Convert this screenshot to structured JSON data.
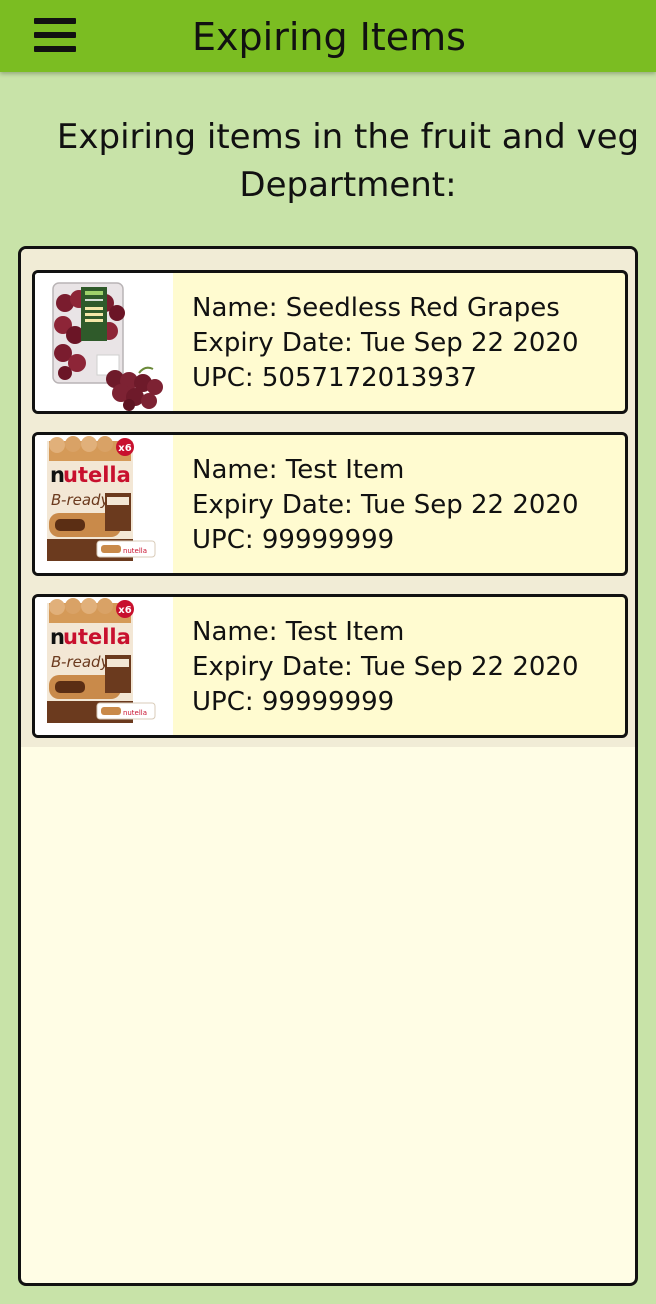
{
  "appbar": {
    "title": "Expiring Items",
    "menu_icon": "hamburger-menu-icon"
  },
  "subtitle": {
    "line1": "Expiring items in the fruit and veg",
    "line2": "Department:"
  },
  "colors": {
    "appbar": "#7bbd22",
    "background": "#c8e3a8",
    "panel": "#fffde5",
    "card": "#fffbd0",
    "border": "#111111"
  },
  "items": [
    {
      "name": "Name: Seedless Red Grapes",
      "expiry": "Expiry Date: Tue Sep 22 2020",
      "upc": "UPC: 5057172013937",
      "image": "red-grapes-package-image",
      "image_text": [
        "ASDA",
        "SEEDLESS",
        "RED",
        "GRAPES"
      ]
    },
    {
      "name": "Name: Test Item",
      "expiry": "Expiry Date: Tue Sep 22 2020",
      "upc": "UPC: 99999999",
      "image": "nutella-b-ready-image",
      "image_text": [
        "nutella",
        "B-ready",
        "x6"
      ]
    },
    {
      "name": "Name: Test Item",
      "expiry": "Expiry Date: Tue Sep 22 2020",
      "upc": "UPC: 99999999",
      "image": "nutella-b-ready-image",
      "image_text": [
        "nutella",
        "B-ready",
        "x6"
      ]
    }
  ]
}
